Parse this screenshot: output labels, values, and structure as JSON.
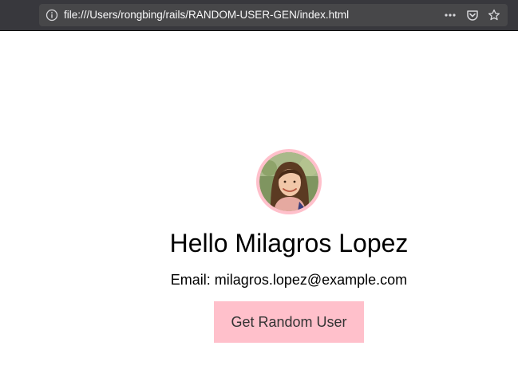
{
  "browser": {
    "url": "file:///Users/rongbing/rails/RANDOM-USER-GEN/index.html"
  },
  "user": {
    "greeting": "Hello Milagros Lopez",
    "email_line": "Email: milagros.lopez@example.com",
    "avatar_alt": "User avatar"
  },
  "actions": {
    "get_random_user_label": "Get Random User"
  },
  "colors": {
    "accent_pink": "#ffc0cb",
    "toolbar_bg": "#38383d",
    "urlbar_bg": "#474749"
  }
}
